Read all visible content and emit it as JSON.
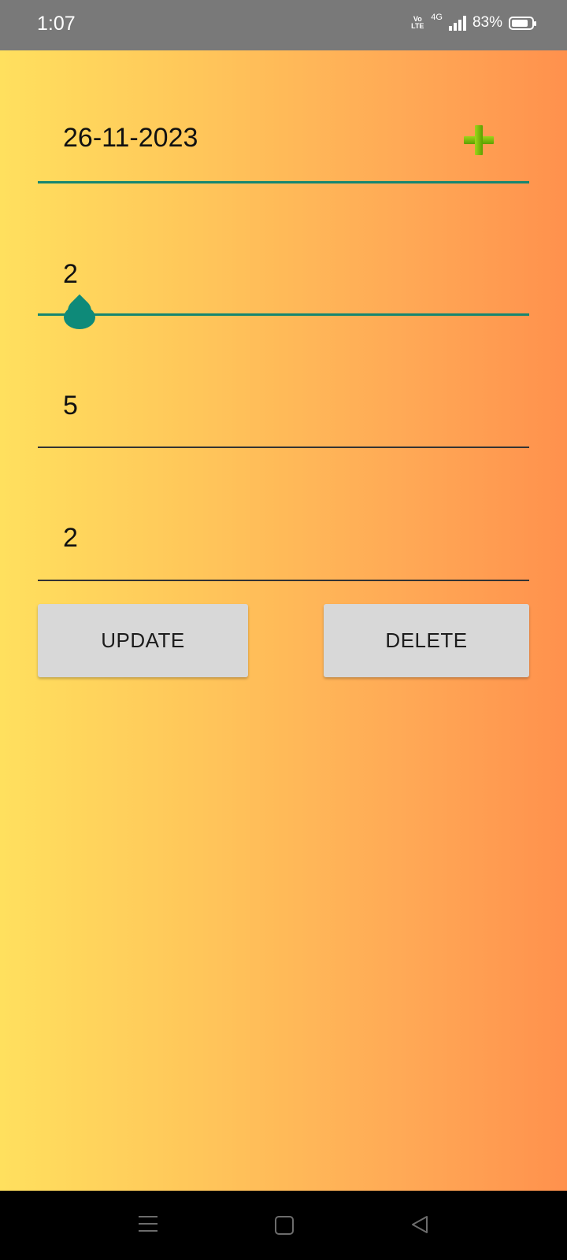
{
  "status_bar": {
    "time": "1:07",
    "volte_top": "Vo",
    "volte_bottom": "LTE",
    "network": "4G",
    "battery_percent": "83%",
    "battery_level": 0.83
  },
  "form": {
    "date_value": "26-11-2023",
    "slider_value": "2",
    "field_one_value": "5",
    "field_two_value": "2",
    "accent_color": "#16866f"
  },
  "buttons": {
    "update_label": "UPDATE",
    "delete_label": "DELETE"
  },
  "icons": {
    "add": "plus-icon",
    "nav_menu": "menu-icon",
    "nav_home": "home-icon",
    "nav_back": "back-icon"
  }
}
